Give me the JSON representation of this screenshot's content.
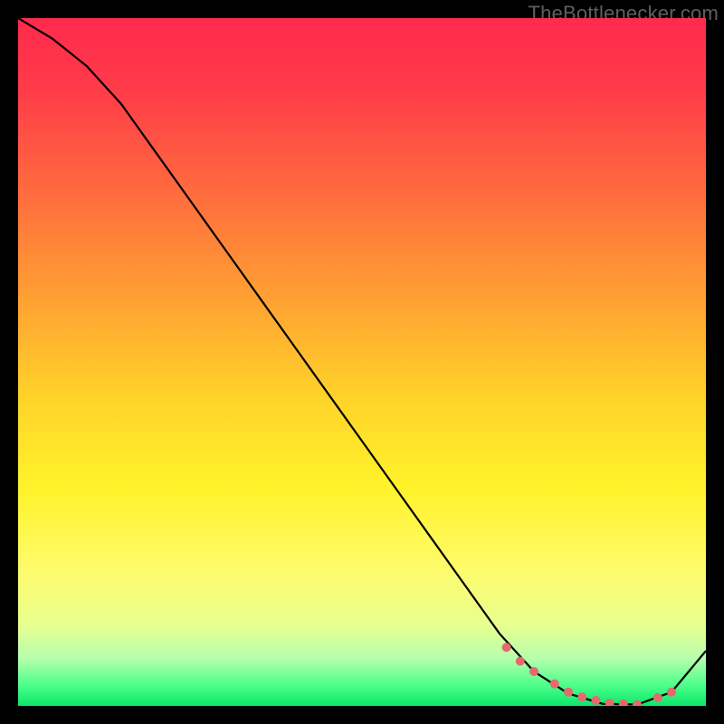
{
  "attribution": "TheBottlenecker.com",
  "chart_data": {
    "type": "line",
    "title": "",
    "xlabel": "",
    "ylabel": "",
    "xlim": [
      0,
      100
    ],
    "ylim": [
      0,
      100
    ],
    "series": [
      {
        "name": "curve",
        "x": [
          0,
          5,
          10,
          15,
          20,
          25,
          30,
          35,
          40,
          45,
          50,
          55,
          60,
          65,
          70,
          75,
          80,
          85,
          90,
          95,
          100
        ],
        "y": [
          100,
          97,
          93,
          87.5,
          80.5,
          73.5,
          66.5,
          59.5,
          52.5,
          45.5,
          38.5,
          31.5,
          24.5,
          17.5,
          10.5,
          5.0,
          1.8,
          0.3,
          0.2,
          2.0,
          8.0
        ]
      }
    ],
    "marker_points": {
      "name": "highlight-dots",
      "color": "#e46a6e",
      "x": [
        71,
        73,
        75,
        78,
        80,
        82,
        84,
        86,
        88,
        90,
        93,
        95
      ],
      "y": [
        8.5,
        6.5,
        5.0,
        3.2,
        2.0,
        1.3,
        0.8,
        0.4,
        0.3,
        0.2,
        1.2,
        2.0
      ]
    }
  }
}
